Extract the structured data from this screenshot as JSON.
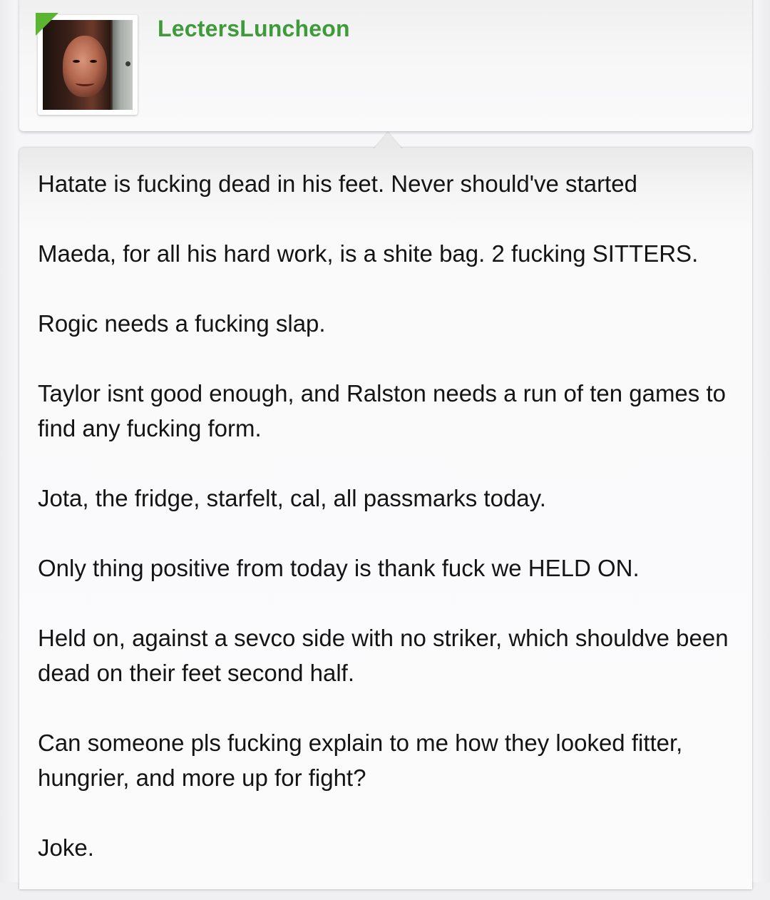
{
  "user": {
    "username": "LectersLuncheon",
    "avatar": "avatar-image",
    "online_status": "online",
    "status_color": "#5cb531",
    "username_color": "#3f9a3a"
  },
  "post": {
    "paragraphs": [
      "Hatate is fucking dead in his feet. Never should've started",
      "Maeda, for all his hard work, is a shite bag. 2 fucking SITTERS.",
      "Rogic needs a fucking slap.",
      "Taylor isnt good enough, and Ralston needs a run of ten games to find any fucking form.",
      "Jota, the fridge, starfelt, cal, all passmarks today.",
      "Only thing positive from today is thank fuck we HELD ON.",
      "Held on, against a sevco side with no striker, which shouldve been dead on their feet second half.",
      "Can someone pls fucking explain to me how they looked fitter, hungrier, and more up for fight?",
      "Joke."
    ]
  }
}
